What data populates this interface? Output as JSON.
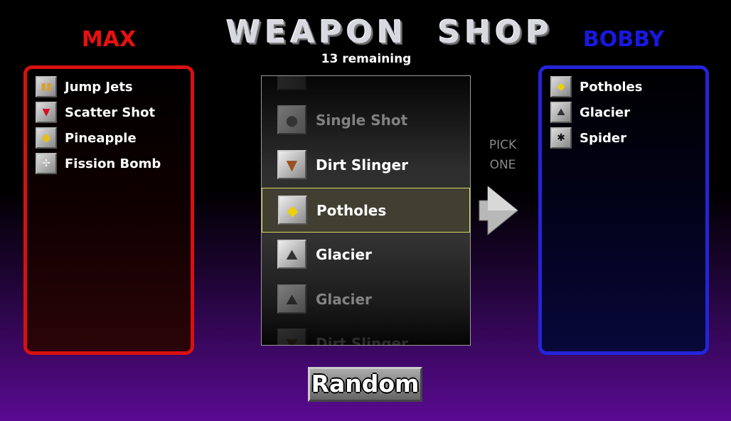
{
  "header": {
    "title": "WEAPON  SHOP",
    "remaining": "13 remaining"
  },
  "players": [
    {
      "name": "MAX",
      "color": "#e81010",
      "weapons": [
        {
          "label": "Jump Jets",
          "icon": "jump-jets-icon"
        },
        {
          "label": "Scatter Shot",
          "icon": "scatter-shot-icon"
        },
        {
          "label": "Pineapple",
          "icon": "pineapple-icon"
        },
        {
          "label": "Fission Bomb",
          "icon": "fission-bomb-icon"
        }
      ]
    },
    {
      "name": "BOBBY",
      "color": "#1818e0",
      "weapons": [
        {
          "label": "Potholes",
          "icon": "bump-sign-icon"
        },
        {
          "label": "Glacier",
          "icon": "glacier-icon"
        },
        {
          "label": "Spider",
          "icon": "spider-icon"
        }
      ]
    }
  ],
  "shop": {
    "items": [
      {
        "label": "Single Shot",
        "icon": "single-shot-icon"
      },
      {
        "label": "Dirt Slinger",
        "icon": "dirt-slinger-icon"
      },
      {
        "label": "Potholes",
        "icon": "bump-sign-icon",
        "selected": true
      },
      {
        "label": "Glacier",
        "icon": "glacier-icon"
      },
      {
        "label": "Glacier",
        "icon": "glacier-icon"
      },
      {
        "label": "Dirt Slinger",
        "icon": "dirt-slinger-icon"
      }
    ]
  },
  "pick": {
    "line1": "PICK",
    "line2": "ONE"
  },
  "random_label": "Random"
}
